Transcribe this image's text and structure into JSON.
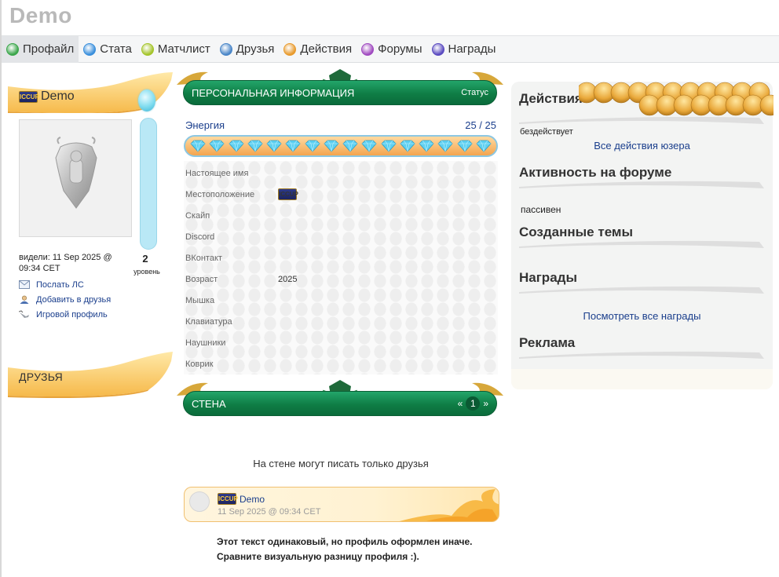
{
  "site": {
    "title": "Demo"
  },
  "tabs": [
    {
      "label": "Профайл",
      "icon": "profile-icon",
      "color": "#3aa64a",
      "active": true
    },
    {
      "label": "Стата",
      "icon": "stats-icon",
      "color": "#3a8fdc",
      "active": false
    },
    {
      "label": "Матчлист",
      "icon": "matchlist-icon",
      "color": "#a4c42a",
      "active": false
    },
    {
      "label": "Друзья",
      "icon": "friends-icon",
      "color": "#4a86c8",
      "active": false
    },
    {
      "label": "Действия",
      "icon": "actions-icon",
      "color": "#e89a2c",
      "active": false
    },
    {
      "label": "Форумы",
      "icon": "forums-icon",
      "color": "#a04ac0",
      "active": false
    },
    {
      "label": "Награды",
      "icon": "awards-icon",
      "color": "#5a4ac0",
      "active": false
    }
  ],
  "profile": {
    "username": "Demo",
    "clan_tag": "ICCUP",
    "level": "2",
    "level_label": "уровень",
    "last_seen": "видели: 11 Sep 2025 @ 09:34 CET",
    "links": [
      {
        "label": "Послать ЛС",
        "icon": "mail-icon"
      },
      {
        "label": "Добавить в друзья",
        "icon": "add-friend-icon"
      },
      {
        "label": "Игровой профиль",
        "icon": "game-profile-icon"
      }
    ],
    "friends_heading": "ДРУЗЬЯ"
  },
  "personal": {
    "heading": "ПЕРСОНАЛЬНАЯ ИНФОРМАЦИЯ",
    "status_label": "Статус",
    "energy_label": "Энергия",
    "energy_value": "25 / 25",
    "energy_fraction": 1.0,
    "gem_count": 16,
    "rows": [
      {
        "key": "Настоящее имя",
        "value": ""
      },
      {
        "key": "Местоположение",
        "value": "",
        "flag": "ICCUP"
      },
      {
        "key": "Скайп",
        "value": ""
      },
      {
        "key": "Discord",
        "value": ""
      },
      {
        "key": "ВКонтакт",
        "value": ""
      },
      {
        "key": "Возраст",
        "value": "2025"
      },
      {
        "key": "Мышка",
        "value": ""
      },
      {
        "key": "Клавиатура",
        "value": ""
      },
      {
        "key": "Наушники",
        "value": ""
      },
      {
        "key": "Коврик",
        "value": ""
      }
    ]
  },
  "wall": {
    "heading": "СТЕНА",
    "pager_prev": "«",
    "pager_page": "1",
    "pager_next": "»",
    "note": "На стене могут писать только друзья",
    "post": {
      "author": "Demo",
      "date": "11 Sep 2025 @ 09:34 CET",
      "text_line1": "Этот текст одинаковый, но профиль оформлен иначе.",
      "text_line2": "Сравните визуальную разницу профиля :)."
    }
  },
  "right": {
    "actions_heading": "Действия",
    "actions_status": "бездействует",
    "actions_link": "Все действия юзера",
    "forum_heading": "Активность на форуме",
    "forum_status": "пассивен",
    "topics_heading": "Созданные темы",
    "awards_heading": "Награды",
    "awards_link": "Посмотреть все награды",
    "ads_heading": "Реклама"
  },
  "colors": {
    "green": "#0f7d45",
    "link": "#1a3e8c",
    "gold": "#f3a54f"
  }
}
